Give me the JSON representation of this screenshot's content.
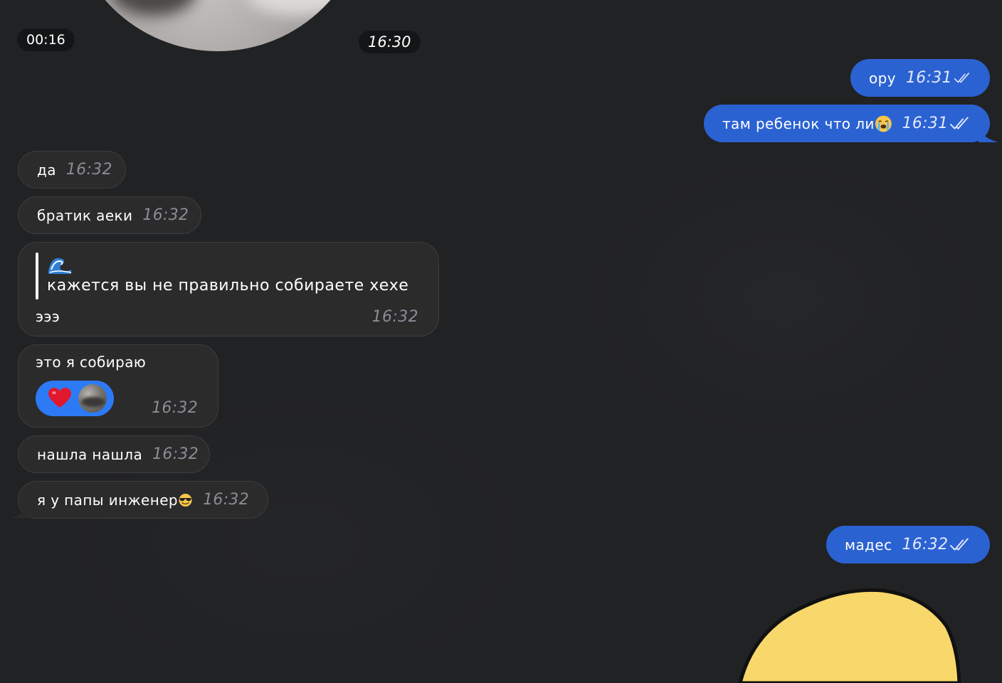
{
  "video_message": {
    "duration": "00:16",
    "time": "16:30"
  },
  "messages": {
    "m1": {
      "text": "ору",
      "time": "16:31",
      "status_icon": "double-check-icon"
    },
    "m2": {
      "text": "там ребенок что ли",
      "time": "16:31",
      "emoji": "crying-face-emoji",
      "status_icon": "double-check-icon"
    },
    "m3": {
      "text": "да",
      "time": "16:32"
    },
    "m4": {
      "text": "братик аеки",
      "time": "16:32"
    },
    "m5": {
      "reply": {
        "emoji": "wave-emoji",
        "text": "кажется вы не правильно собираете хехе"
      },
      "text": "эээ",
      "time": "16:32"
    },
    "m6": {
      "text": "это я собираю",
      "time": "16:32",
      "reaction": {
        "emoji": "red-heart-emoji",
        "avatar": "user-avatar"
      }
    },
    "m7": {
      "text": "нашла нашла",
      "time": "16:32"
    },
    "m8": {
      "text": "я у папы инженер",
      "time": "16:32",
      "emoji": "sunglasses-face-emoji"
    },
    "m9": {
      "text": "мадес",
      "time": "16:32",
      "status_icon": "double-check-icon"
    }
  },
  "colors": {
    "background": "#212224",
    "incoming_bubble": "#2b2b2c",
    "outgoing_bubble": "#2b62d2",
    "reaction_pill": "#2d7af6",
    "sticker_yellow": "#f8d86a"
  }
}
